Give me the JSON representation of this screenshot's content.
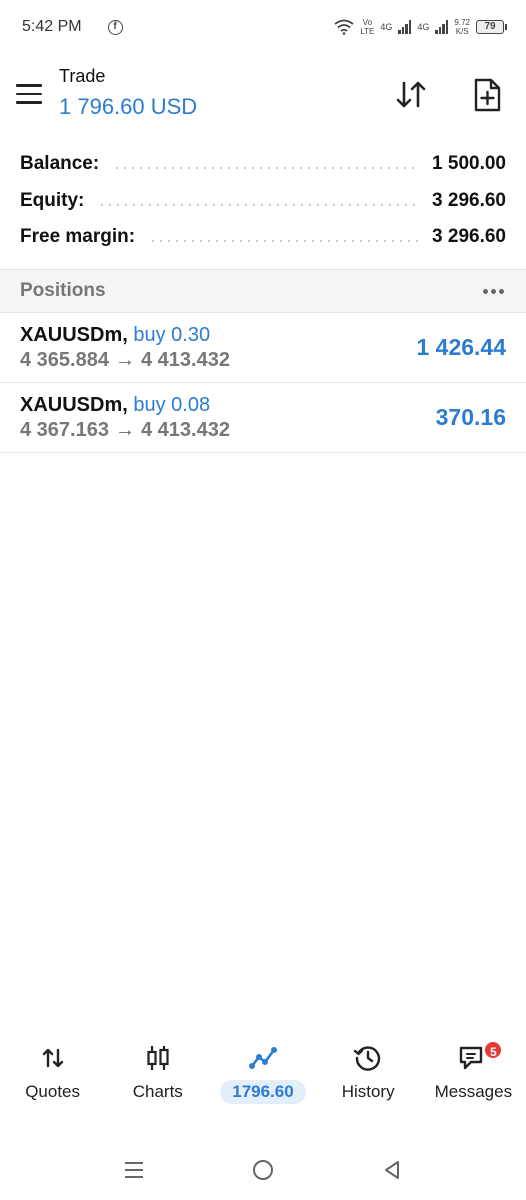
{
  "status_bar": {
    "time": "5:42 PM",
    "fb": "f",
    "vo": "Vo",
    "lte": "LTE",
    "net1": "4G",
    "net2": "4G",
    "speed": "9.72",
    "speed_unit": "K/S",
    "battery": "79"
  },
  "header": {
    "title": "Trade",
    "balance": "1 796.60 USD"
  },
  "summary": [
    {
      "label": "Balance:",
      "value": "1 500.00"
    },
    {
      "label": "Equity:",
      "value": "3 296.60"
    },
    {
      "label": "Free margin:",
      "value": "3 296.60"
    }
  ],
  "positions": {
    "title": "Positions",
    "items": [
      {
        "symbol": "XAUUSDm,",
        "type": "buy 0.30",
        "open": "4 365.884",
        "arrow": "→",
        "current": "4 413.432",
        "profit": "1 426.44"
      },
      {
        "symbol": "XAUUSDm,",
        "type": "buy 0.08",
        "open": "4 367.163",
        "arrow": "→",
        "current": "4 413.432",
        "profit": "370.16"
      }
    ]
  },
  "nav": {
    "quotes": "Quotes",
    "charts": "Charts",
    "trade": "1796.60",
    "history": "History",
    "messages": "Messages",
    "messages_badge": "5"
  },
  "colors": {
    "accent": "#2c7cd1",
    "badge": "#e53935",
    "active_bg": "#e3eefb"
  }
}
